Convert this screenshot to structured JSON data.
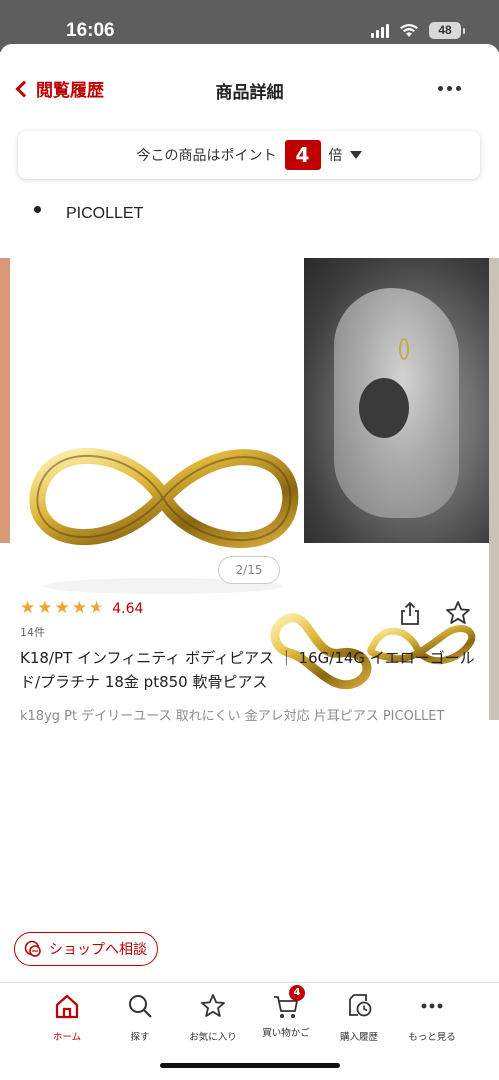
{
  "status_bar": {
    "time": "16:06",
    "battery": "48"
  },
  "header": {
    "back_label": "閲覧履歴",
    "title": "商品詳細"
  },
  "points_banner": {
    "prefix": "今この商品はポイント",
    "multiplier": "4",
    "suffix": "倍"
  },
  "shop": {
    "logo_text": "PICOLLET",
    "name": "PICOLLET"
  },
  "carousel": {
    "indicator": "2/15"
  },
  "product": {
    "rating_value": "4.64",
    "rating_stars": 4.64,
    "review_count": "14件",
    "title": "K18/PT インフィニティ ボディピアス ｜ 16G/14G イエローゴールド/プラチナ 18金 pt850 軟骨ピアス",
    "subtitle": "k18yg Pt デイリーユース 取れにくい 金アレ対応 片耳ピアス PICOLLET"
  },
  "consult_button": {
    "label": "ショップへ相談"
  },
  "bottom_nav": {
    "items": [
      {
        "label": "ホーム",
        "icon": "home-icon"
      },
      {
        "label": "探す",
        "icon": "search-icon"
      },
      {
        "label": "お気に入り",
        "icon": "star-icon"
      },
      {
        "label": "買い物かご",
        "icon": "cart-icon"
      },
      {
        "label": "購入履歴",
        "icon": "history-icon"
      },
      {
        "label": "もっと見る",
        "icon": "more-icon"
      }
    ],
    "cart_count": "4"
  },
  "colors": {
    "accent": "#bf0000",
    "star": "#f2a32f"
  }
}
